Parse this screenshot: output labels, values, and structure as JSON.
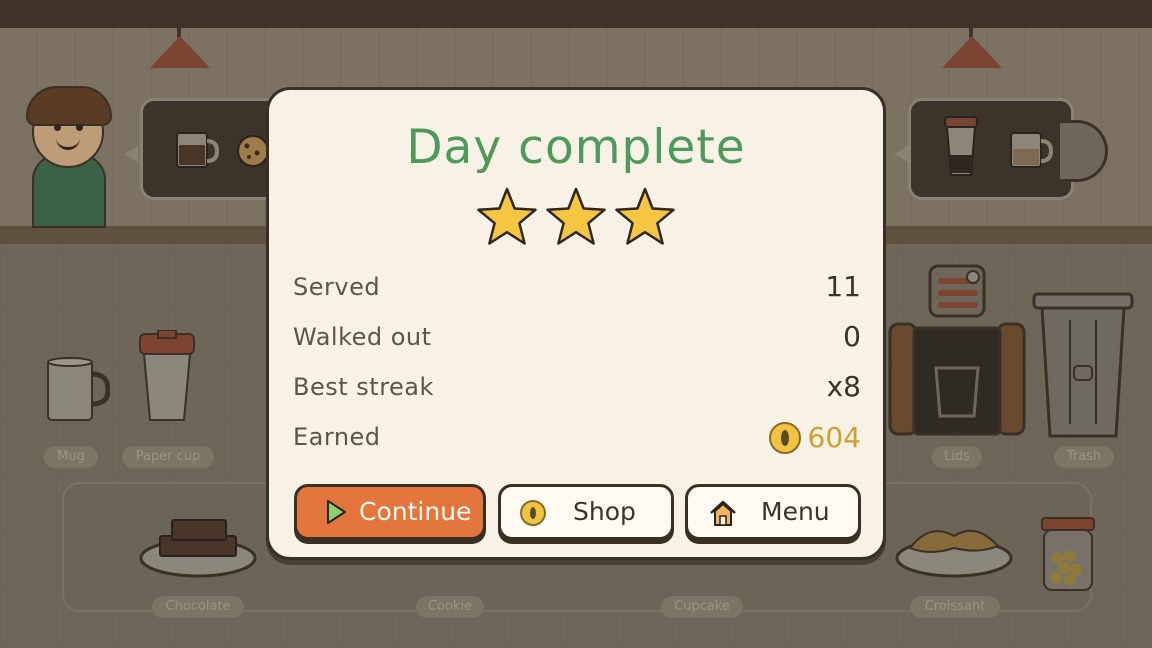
{
  "modal": {
    "title": "Day complete",
    "stars_earned": 3,
    "stars_total": 3,
    "stats": [
      {
        "label": "Served",
        "value": "11"
      },
      {
        "label": "Walked out",
        "value": "0"
      },
      {
        "label": "Best streak",
        "value": "x8"
      },
      {
        "label": "Earned",
        "value": "604"
      }
    ],
    "buttons": {
      "continue": "Continue",
      "shop": "Shop",
      "menu": "Menu"
    }
  },
  "stations": {
    "mug": "Mug",
    "paper_cup": "Paper cup",
    "lids": "Lids",
    "trash": "Trash",
    "chocolate": "Chocolate",
    "cookie": "Cookie",
    "cupcake": "Cupcake",
    "croissant": "Croissant"
  },
  "colors": {
    "title_green": "#4d9a5b",
    "continue_orange": "#e4763d",
    "coin_gold": "#cf9e2c",
    "star_yellow": "#f6c542",
    "panel": "#f8f1e6"
  },
  "icons": [
    "play-icon",
    "coin-icon",
    "home-icon",
    "star-icon"
  ]
}
